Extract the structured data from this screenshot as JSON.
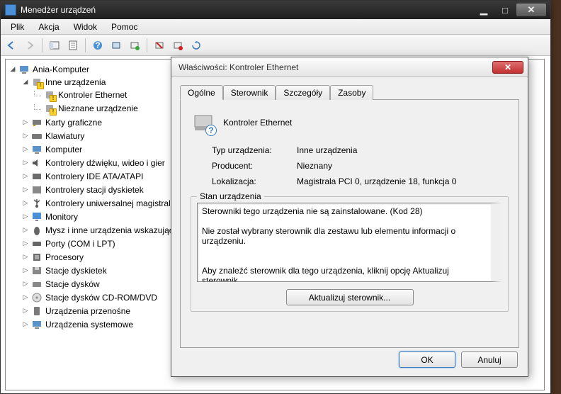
{
  "window": {
    "title": "Menedżer urządzeń",
    "menu": {
      "file": "Plik",
      "action": "Akcja",
      "view": "Widok",
      "help": "Pomoc"
    }
  },
  "tree": {
    "root": "Ania-Komputer",
    "other_devices": {
      "label": "Inne urządzenia",
      "children": {
        "ethernet": "Kontroler Ethernet",
        "unknown": "Nieznane urządzenie"
      }
    },
    "categories": [
      "Karty graficzne",
      "Klawiatury",
      "Komputer",
      "Kontrolery dźwięku, wideo i gier",
      "Kontrolery IDE ATA/ATAPI",
      "Kontrolery stacji dyskietek",
      "Kontrolery uniwersalnej magistrali",
      "Monitory",
      "Mysz i inne urządzenia wskazujące",
      "Porty (COM i LPT)",
      "Procesory",
      "Stacje dyskietek",
      "Stacje dysków",
      "Stacje dysków CD-ROM/DVD",
      "Urządzenia przenośne",
      "Urządzenia systemowe"
    ]
  },
  "dialog": {
    "title": "Właściwości: Kontroler Ethernet",
    "tabs": {
      "general": "Ogólne",
      "driver": "Sterownik",
      "details": "Szczegóły",
      "resources": "Zasoby"
    },
    "device_name": "Kontroler Ethernet",
    "props": {
      "type_label": "Typ urządzenia:",
      "type_value": "Inne urządzenia",
      "manufacturer_label": "Producent:",
      "manufacturer_value": "Nieznany",
      "location_label": "Lokalizacja:",
      "location_value": "Magistrala PCI 0, urządzenie 18, funkcja 0"
    },
    "status_group": "Stan urządzenia",
    "status_text": "Sterowniki tego urządzenia nie są zainstalowane. (Kod 28)\n\nNie został wybrany sterownik dla zestawu lub elementu informacji o urządzeniu.\n\n\nAby znaleźć sterownik dla tego urządzenia, kliknij opcję Aktualizuj sterownik.",
    "update_button": "Aktualizuj sterownik...",
    "ok": "OK",
    "cancel": "Anuluj"
  }
}
